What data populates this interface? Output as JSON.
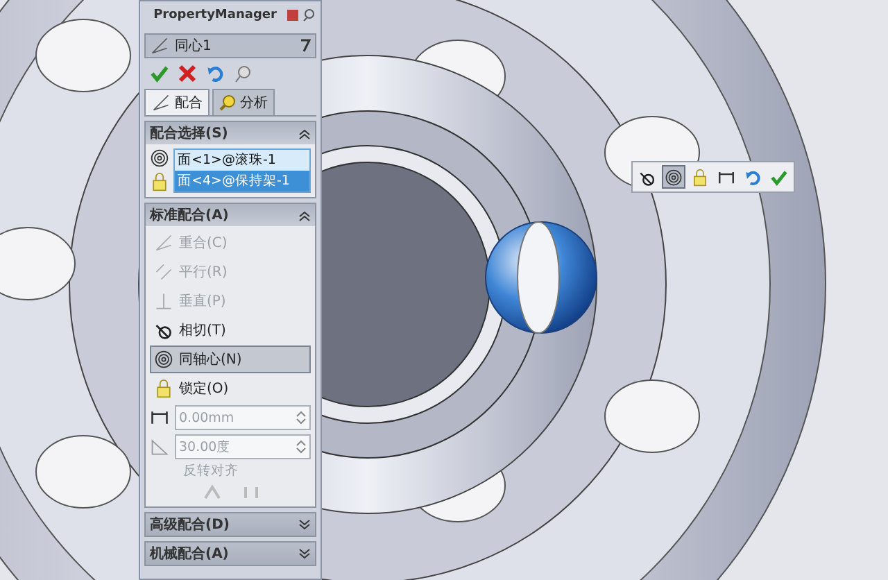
{
  "property_manager": {
    "title": "PropertyManager",
    "feature": {
      "name": "同心1"
    },
    "tabs": [
      {
        "label": "配合",
        "selected": true
      },
      {
        "label": "分析",
        "selected": false
      }
    ],
    "selections": {
      "title": "配合选择(S)",
      "expanded": true,
      "items": [
        {
          "label": "面<1>@滚珠-1",
          "selected": false
        },
        {
          "label": "面<4>@保持架-1",
          "selected": true
        }
      ]
    },
    "standard_mates": {
      "title": "标准配合(A)",
      "expanded": true,
      "items": [
        {
          "kind": "coincident",
          "label": "重合(C)",
          "disabled": true,
          "selected": false
        },
        {
          "kind": "parallel",
          "label": "平行(R)",
          "disabled": true,
          "selected": false
        },
        {
          "kind": "perpendicular",
          "label": "垂直(P)",
          "disabled": true,
          "selected": false
        },
        {
          "kind": "tangent",
          "label": "相切(T)",
          "disabled": false,
          "selected": false
        },
        {
          "kind": "concentric",
          "label": "同轴心(N)",
          "disabled": false,
          "selected": true
        },
        {
          "kind": "lock",
          "label": "锁定(O)",
          "disabled": false,
          "selected": false
        }
      ],
      "distance": {
        "value": "0.00mm",
        "disabled": true
      },
      "angle": {
        "value": "30.00度",
        "disabled": true
      },
      "flip_label": "反转对齐"
    },
    "advanced": {
      "title": "高级配合(D)",
      "expanded": false
    },
    "mechanical": {
      "title": "机械配合(A)",
      "expanded": false
    }
  },
  "mini_toolbar": {
    "buttons": [
      {
        "kind": "tangent",
        "selected": false
      },
      {
        "kind": "concentric",
        "selected": true
      },
      {
        "kind": "lock",
        "selected": false
      },
      {
        "kind": "distance",
        "selected": false
      },
      {
        "kind": "undo",
        "selected": false
      },
      {
        "kind": "ok",
        "selected": false
      }
    ]
  }
}
